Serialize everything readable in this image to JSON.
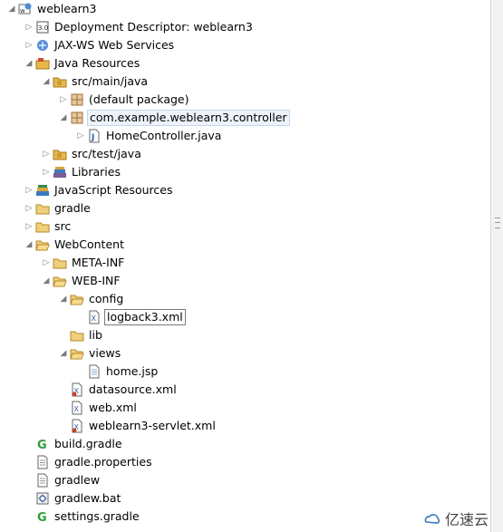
{
  "tree": {
    "project": "weblearn3",
    "deployment_descriptor": "Deployment Descriptor: weblearn3",
    "jaxws": "JAX-WS Web Services",
    "java_resources": "Java Resources",
    "src_main_java": "src/main/java",
    "default_package": "(default package)",
    "controller_package": "com.example.weblearn3.controller",
    "home_controller": "HomeController.java",
    "src_test_java": "src/test/java",
    "libraries": "Libraries",
    "javascript_resources": "JavaScript Resources",
    "gradle": "gradle",
    "src": "src",
    "webcontent": "WebContent",
    "meta_inf": "META-INF",
    "web_inf": "WEB-INF",
    "config": "config",
    "logback": "logback3.xml",
    "lib": "lib",
    "views": "views",
    "home_jsp": "home.jsp",
    "datasource": "datasource.xml",
    "web_xml": "web.xml",
    "servlet_xml": "weblearn3-servlet.xml",
    "build_gradle": "build.gradle",
    "gradle_properties": "gradle.properties",
    "gradlew": "gradlew",
    "gradlew_bat": "gradlew.bat",
    "settings_gradle": "settings.gradle"
  },
  "watermark": {
    "text": "亿速云"
  },
  "colors": {
    "folder": "#e8b64a",
    "gradle_green": "#2e9e3a",
    "selection": "#eef3fb"
  }
}
